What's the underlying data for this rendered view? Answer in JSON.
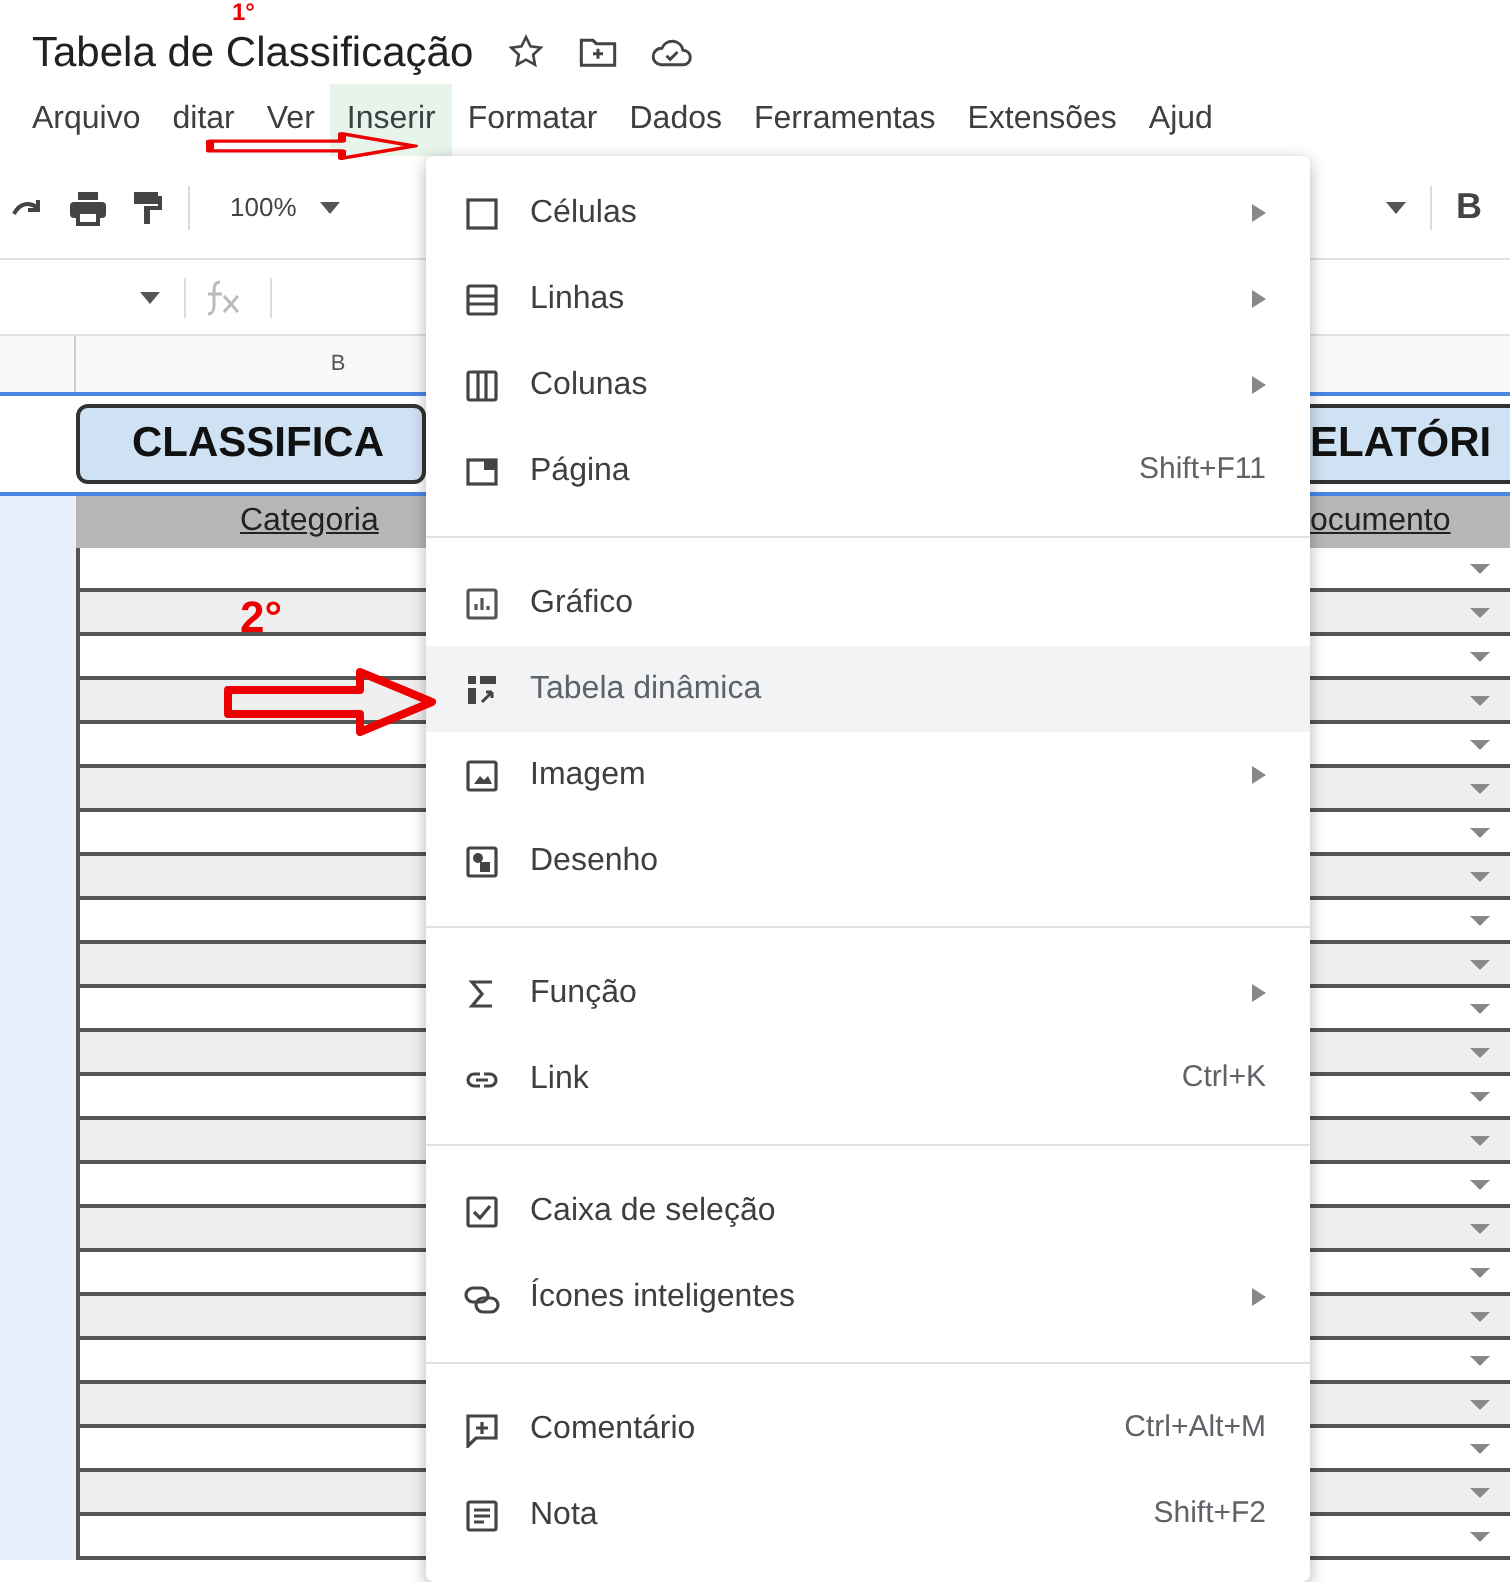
{
  "document": {
    "title": "Tabela de Classificação"
  },
  "menubar": [
    {
      "label": "Arquivo",
      "selected": false
    },
    {
      "label": "ditar",
      "selected": false
    },
    {
      "label": "Ver",
      "selected": false
    },
    {
      "label": "Inserir",
      "selected": true
    },
    {
      "label": "Formatar",
      "selected": false
    },
    {
      "label": "Dados",
      "selected": false
    },
    {
      "label": "Ferramentas",
      "selected": false
    },
    {
      "label": "Extensões",
      "selected": false
    },
    {
      "label": "Ajud",
      "selected": false
    }
  ],
  "toolbar": {
    "zoom": "100%",
    "bold": "B"
  },
  "sheet": {
    "column_header": "B",
    "title_left": "CLASSIFICA",
    "title_right": "ELATÓRI",
    "header_left": "Categoria",
    "header_right": "ocumento"
  },
  "menu": {
    "groups": [
      [
        {
          "kind": "square",
          "label": "Células",
          "submenu": true,
          "selected": false
        },
        {
          "kind": "rows",
          "label": "Linhas",
          "submenu": true,
          "selected": false
        },
        {
          "kind": "columns",
          "label": "Colunas",
          "submenu": true,
          "selected": false
        },
        {
          "kind": "page",
          "label": "Página",
          "shortcut": "Shift+F11",
          "submenu": false,
          "selected": false
        }
      ],
      [
        {
          "kind": "chart",
          "label": "Gráfico",
          "submenu": false,
          "selected": false
        },
        {
          "kind": "pivot",
          "label": "Tabela dinâmica",
          "submenu": false,
          "selected": true
        },
        {
          "kind": "image",
          "label": "Imagem",
          "submenu": true,
          "selected": false
        },
        {
          "kind": "drawing",
          "label": "Desenho",
          "submenu": false,
          "selected": false
        }
      ],
      [
        {
          "kind": "sigma",
          "label": "Função",
          "submenu": true,
          "selected": false
        },
        {
          "kind": "link",
          "label": "Link",
          "shortcut": "Ctrl+K",
          "submenu": false,
          "selected": false
        }
      ],
      [
        {
          "kind": "checkbox",
          "label": "Caixa de seleção",
          "submenu": false,
          "selected": false
        },
        {
          "kind": "chips",
          "label": "Ícones inteligentes",
          "submenu": true,
          "selected": false
        }
      ],
      [
        {
          "kind": "comment",
          "label": "Comentário",
          "shortcut": "Ctrl+Alt+M",
          "submenu": false,
          "selected": false
        },
        {
          "kind": "note",
          "label": "Nota",
          "shortcut": "Shift+F2",
          "submenu": false,
          "selected": false
        }
      ]
    ]
  },
  "annotations": [
    "1°",
    "2°"
  ]
}
